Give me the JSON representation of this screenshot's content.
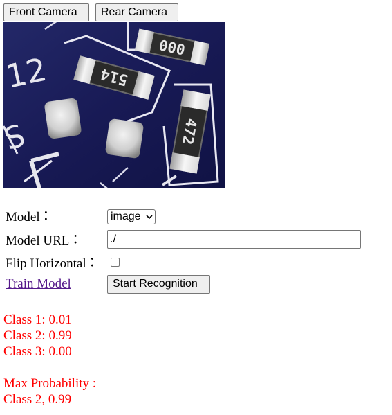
{
  "camera_buttons": {
    "front": "Front Camera",
    "rear": "Rear Camera"
  },
  "preview": {
    "silkscreen_left": "12",
    "silkscreen_s": "S",
    "resistor_top_code": "000",
    "resistor_mid_code": "514",
    "resistor_right_code": "472"
  },
  "form": {
    "model_label": "Model",
    "model_url_label": "Model URL",
    "flip_label": "Flip Horizontal",
    "colon": "：",
    "model_selected": "image",
    "model_url_value": "./",
    "flip_checked": false
  },
  "actions": {
    "train_link": "Train Model",
    "start_button": "Start Recognition"
  },
  "results": {
    "class1": "Class 1: 0.01",
    "class2": "Class 2: 0.99",
    "class3": "Class 3: 0.00",
    "max_label": "Max Probability :",
    "max_value": "Class 2, 0.99"
  },
  "colors": {
    "result_text": "#ff0000",
    "link": "#551a8b",
    "pcb_board": "#1b1d5c"
  }
}
